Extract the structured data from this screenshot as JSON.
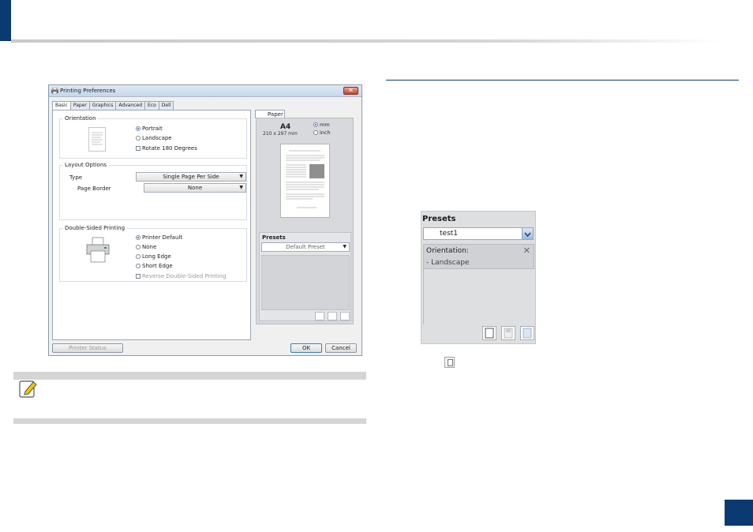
{
  "dialog": {
    "title": "Printing Preferences",
    "close_glyph": "✕",
    "tabs": [
      "Basic",
      "Paper",
      "Graphics",
      "Advanced",
      "Eco",
      "Dell"
    ],
    "orientation": {
      "title": "Orientation",
      "portrait": "Portrait",
      "landscape": "Landscape",
      "rotate": "Rotate 180 Degrees",
      "selected": "Portrait"
    },
    "layout": {
      "title": "Layout Options",
      "type_label": "Type",
      "type_value": "Single Page Per Side",
      "border_label": "Page Border",
      "border_value": "None"
    },
    "duplex": {
      "title": "Double-Sided Printing",
      "options": [
        "Printer Default",
        "None",
        "Long Edge",
        "Short Edge"
      ],
      "selected": "Printer Default",
      "reverse": "Reverse Double-Sided Printing"
    },
    "preview": {
      "tab": "Paper",
      "size_name": "A4",
      "size_dims": "210 x 297 mm",
      "unit_mm": "mm",
      "unit_inch": "inch",
      "presets_label": "Presets",
      "presets_value": "Default Preset"
    },
    "footer": {
      "printer_status": "Printer Status",
      "ok": "OK",
      "cancel": "Cancel"
    }
  },
  "presets_zoom": {
    "title": "Presets",
    "selected": "test1",
    "card_line1": "Orientation:",
    "card_line2": "- Landscape",
    "remove_glyph": "✕"
  },
  "colors": {
    "accent": "#0b3a73",
    "note_bar": "#d5d5d5",
    "note_icon": "#f5c400"
  },
  "icons": [
    "printer-icon",
    "close-icon",
    "document-icon",
    "printer-duplex-icon",
    "note-pencil-icon",
    "new-preset-icon",
    "save-preset-icon",
    "delete-preset-icon"
  ]
}
